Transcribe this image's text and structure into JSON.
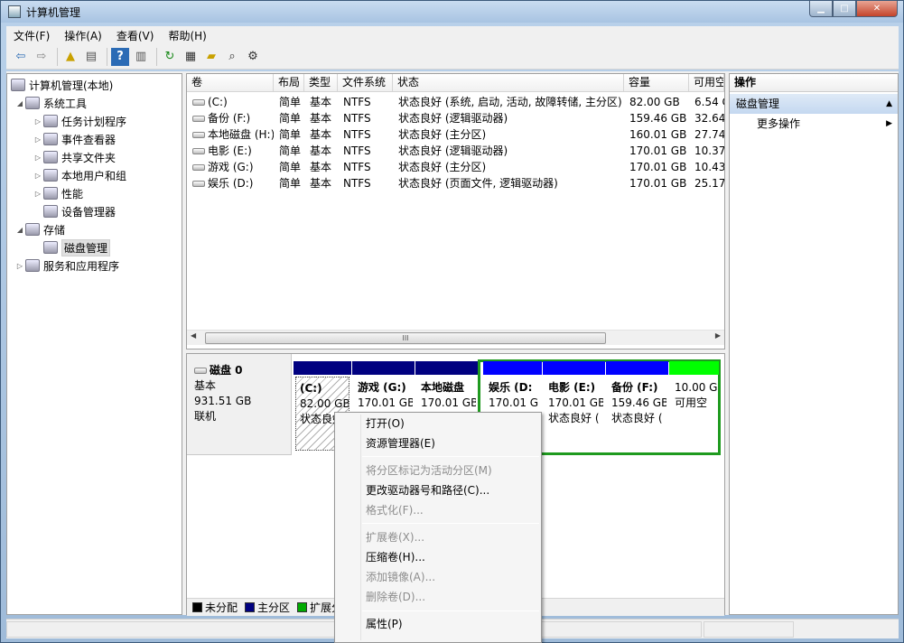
{
  "window": {
    "title": "计算机管理"
  },
  "menu": [
    "文件(F)",
    "操作(A)",
    "查看(V)",
    "帮助(H)"
  ],
  "tree": {
    "root": "计算机管理(本地)",
    "system_tools": "系统工具",
    "task_scheduler": "任务计划程序",
    "event_viewer": "事件查看器",
    "shared_folders": "共享文件夹",
    "local_users": "本地用户和组",
    "performance": "性能",
    "device_manager": "设备管理器",
    "storage": "存储",
    "disk_management": "磁盘管理",
    "services_apps": "服务和应用程序"
  },
  "volumes": {
    "headers": [
      "卷",
      "布局",
      "类型",
      "文件系统",
      "状态",
      "容量",
      "可用空"
    ],
    "rows": [
      {
        "vol": "(C:)",
        "layout": "简单",
        "type": "基本",
        "fs": "NTFS",
        "status": "状态良好 (系统, 启动, 活动, 故障转储, 主分区)",
        "cap": "82.00 GB",
        "free": "6.54 C"
      },
      {
        "vol": "备份 (F:)",
        "layout": "简单",
        "type": "基本",
        "fs": "NTFS",
        "status": "状态良好 (逻辑驱动器)",
        "cap": "159.46 GB",
        "free": "32.64"
      },
      {
        "vol": "本地磁盘 (H:)",
        "layout": "简单",
        "type": "基本",
        "fs": "NTFS",
        "status": "状态良好 (主分区)",
        "cap": "160.01 GB",
        "free": "27.74"
      },
      {
        "vol": "电影 (E:)",
        "layout": "简单",
        "type": "基本",
        "fs": "NTFS",
        "status": "状态良好 (逻辑驱动器)",
        "cap": "170.01 GB",
        "free": "10.37"
      },
      {
        "vol": "游戏 (G:)",
        "layout": "简单",
        "type": "基本",
        "fs": "NTFS",
        "status": "状态良好 (主分区)",
        "cap": "170.01 GB",
        "free": "10.43"
      },
      {
        "vol": "娱乐 (D:)",
        "layout": "简单",
        "type": "基本",
        "fs": "NTFS",
        "status": "状态良好 (页面文件, 逻辑驱动器)",
        "cap": "170.01 GB",
        "free": "25.17"
      }
    ]
  },
  "scroll_thumb": "III",
  "disk0": {
    "name": "磁盘 0",
    "type": "基本",
    "size": "931.51 GB",
    "state": "联机"
  },
  "partitions": [
    {
      "name": "(C:)",
      "size": "82.00 GB",
      "status": "状态良好"
    },
    {
      "name": "游戏 (G:)",
      "size": "170.01 GB",
      "status": ""
    },
    {
      "name": "本地磁盘",
      "size": "170.01 GB",
      "status": ""
    },
    {
      "name": "娱乐 (D:",
      "size": "170.01 G",
      "status": ""
    },
    {
      "name": "电影 (E:)",
      "size": "170.01 GB",
      "status": "状态良好 ("
    },
    {
      "name": "备份 (F:)",
      "size": "159.46 GB",
      "status": "状态良好 ("
    },
    {
      "name": "",
      "size": "10.00 G",
      "status": "可用空"
    }
  ],
  "legend": [
    "未分配",
    "主分区",
    "扩展分"
  ],
  "colors": {
    "unallocated": "#000000",
    "primary": "#000080",
    "extended": "#00aa00",
    "logical": "#0000ff",
    "free": "#00ff00"
  },
  "actions": {
    "header": "操作",
    "selected": "磁盘管理",
    "more": "更多操作"
  },
  "context_menu": {
    "open": "打开(O)",
    "explorer": "资源管理器(E)",
    "mark_active": "将分区标记为活动分区(M)",
    "change_letter": "更改驱动器号和路径(C)...",
    "format": "格式化(F)...",
    "extend": "扩展卷(X)...",
    "shrink": "压缩卷(H)...",
    "add_mirror": "添加镜像(A)...",
    "delete": "删除卷(D)...",
    "properties": "属性(P)"
  }
}
